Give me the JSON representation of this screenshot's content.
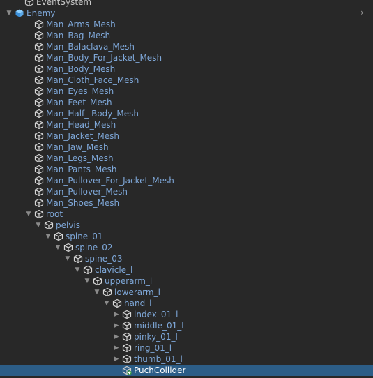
{
  "hierarchy": {
    "rows": [
      {
        "label": "EventSystem",
        "depth": 1,
        "arrow": "none",
        "icon": "cube-icon",
        "style": "plain"
      },
      {
        "label": "Enemy",
        "depth": 0,
        "arrow": "down",
        "icon": "prefab-icon",
        "style": "prefab"
      },
      {
        "label": "Man_Arms_Mesh",
        "depth": 2,
        "arrow": "none",
        "icon": "cube-icon",
        "style": "prefab"
      },
      {
        "label": "Man_Bag_Mesh",
        "depth": 2,
        "arrow": "none",
        "icon": "cube-icon",
        "style": "prefab"
      },
      {
        "label": "Man_Balaclava_Mesh",
        "depth": 2,
        "arrow": "none",
        "icon": "cube-icon",
        "style": "prefab"
      },
      {
        "label": "Man_Body_For_Jacket_Mesh",
        "depth": 2,
        "arrow": "none",
        "icon": "cube-icon",
        "style": "prefab"
      },
      {
        "label": "Man_Body_Mesh",
        "depth": 2,
        "arrow": "none",
        "icon": "cube-icon",
        "style": "prefab"
      },
      {
        "label": "Man_Cloth_Face_Mesh",
        "depth": 2,
        "arrow": "none",
        "icon": "cube-icon",
        "style": "prefab"
      },
      {
        "label": "Man_Eyes_Mesh",
        "depth": 2,
        "arrow": "none",
        "icon": "cube-icon",
        "style": "prefab"
      },
      {
        "label": "Man_Feet_Mesh",
        "depth": 2,
        "arrow": "none",
        "icon": "cube-icon",
        "style": "prefab"
      },
      {
        "label": "Man_Half_ Body_Mesh",
        "depth": 2,
        "arrow": "none",
        "icon": "cube-icon",
        "style": "prefab"
      },
      {
        "label": "Man_Head_Mesh",
        "depth": 2,
        "arrow": "none",
        "icon": "cube-icon",
        "style": "prefab"
      },
      {
        "label": "Man_Jacket_Mesh",
        "depth": 2,
        "arrow": "none",
        "icon": "cube-icon",
        "style": "prefab"
      },
      {
        "label": "Man_Jaw_Mesh",
        "depth": 2,
        "arrow": "none",
        "icon": "cube-icon",
        "style": "prefab"
      },
      {
        "label": "Man_Legs_Mesh",
        "depth": 2,
        "arrow": "none",
        "icon": "cube-icon",
        "style": "prefab"
      },
      {
        "label": "Man_Pants_Mesh",
        "depth": 2,
        "arrow": "none",
        "icon": "cube-icon",
        "style": "prefab"
      },
      {
        "label": "Man_Pullover_For_Jacket_Mesh",
        "depth": 2,
        "arrow": "none",
        "icon": "cube-icon",
        "style": "prefab"
      },
      {
        "label": "Man_Pullover_Mesh",
        "depth": 2,
        "arrow": "none",
        "icon": "cube-icon",
        "style": "prefab"
      },
      {
        "label": "Man_Shoes_Mesh",
        "depth": 2,
        "arrow": "none",
        "icon": "cube-icon",
        "style": "prefab"
      },
      {
        "label": "root",
        "depth": 2,
        "arrow": "down",
        "icon": "cube-icon",
        "style": "prefab"
      },
      {
        "label": "pelvis",
        "depth": 3,
        "arrow": "down",
        "icon": "cube-icon",
        "style": "prefab"
      },
      {
        "label": "spine_01",
        "depth": 4,
        "arrow": "down",
        "icon": "cube-icon",
        "style": "prefab"
      },
      {
        "label": "spine_02",
        "depth": 5,
        "arrow": "down",
        "icon": "cube-icon",
        "style": "prefab"
      },
      {
        "label": "spine_03",
        "depth": 6,
        "arrow": "down",
        "icon": "cube-icon",
        "style": "prefab"
      },
      {
        "label": "clavicle_l",
        "depth": 7,
        "arrow": "down",
        "icon": "cube-icon",
        "style": "prefab"
      },
      {
        "label": "upperarm_l",
        "depth": 8,
        "arrow": "down",
        "icon": "cube-icon",
        "style": "prefab"
      },
      {
        "label": "lowerarm_l",
        "depth": 9,
        "arrow": "down",
        "icon": "cube-icon",
        "style": "prefab"
      },
      {
        "label": "hand_l",
        "depth": 10,
        "arrow": "down",
        "icon": "cube-icon",
        "style": "prefab"
      },
      {
        "label": "index_01_l",
        "depth": 11,
        "arrow": "right",
        "icon": "cube-icon",
        "style": "prefab"
      },
      {
        "label": "middle_01_l",
        "depth": 11,
        "arrow": "right",
        "icon": "cube-icon",
        "style": "prefab"
      },
      {
        "label": "pinky_01_l",
        "depth": 11,
        "arrow": "right",
        "icon": "cube-icon",
        "style": "prefab"
      },
      {
        "label": "ring_01_l",
        "depth": 11,
        "arrow": "right",
        "icon": "cube-icon",
        "style": "prefab"
      },
      {
        "label": "thumb_01_l",
        "depth": 11,
        "arrow": "right",
        "icon": "cube-icon",
        "style": "prefab"
      },
      {
        "label": "PuchCollider",
        "depth": 11,
        "arrow": "none",
        "icon": "added-cube-icon",
        "style": "selected"
      }
    ],
    "selected_row": "PuchCollider",
    "colors": {
      "background": "#282828",
      "prefab_text": "#7ea7d8",
      "plain_text": "#c8c8c8",
      "selection": "#2c5d87",
      "prefab_icon": "#5aa8e8"
    }
  }
}
